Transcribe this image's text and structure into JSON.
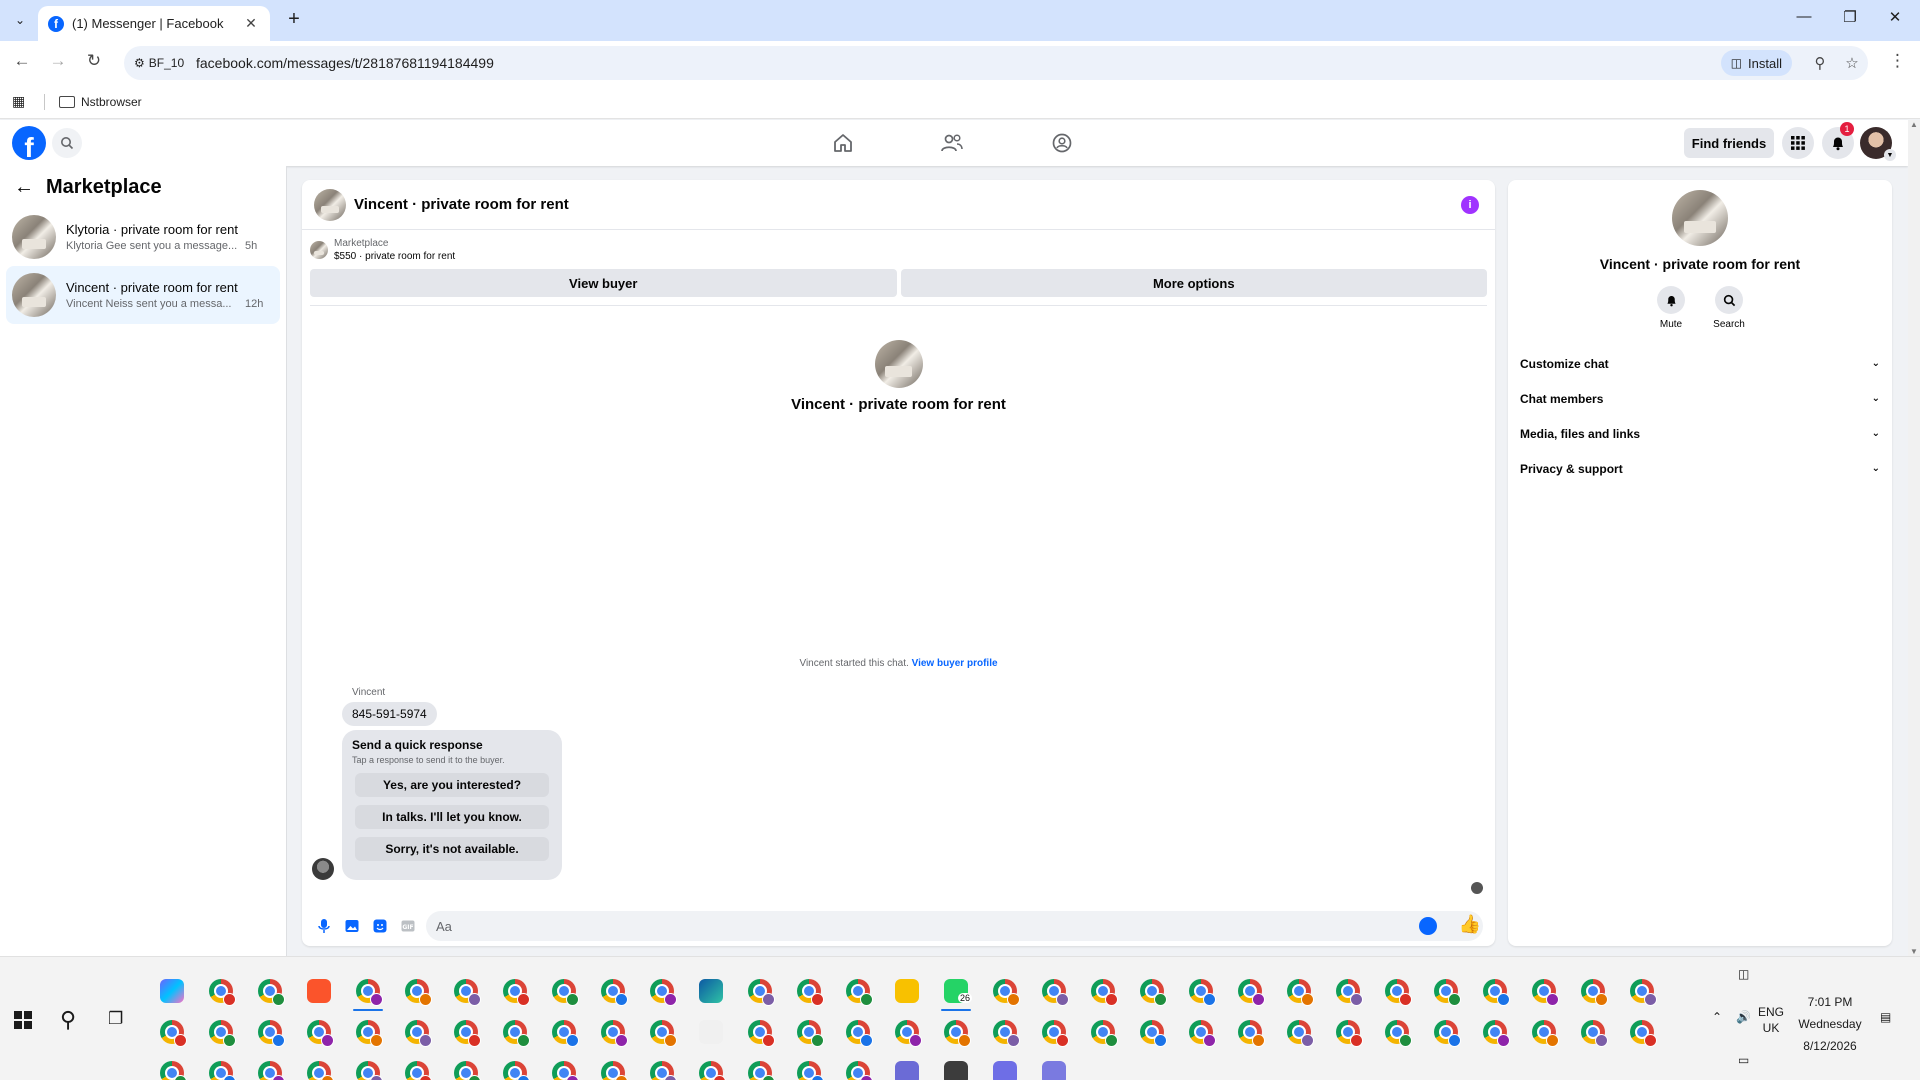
{
  "browser": {
    "tab_title": "(1) Messenger | Facebook",
    "profile_label": "BF_10",
    "url": "facebook.com/messages/t/28187681194184499",
    "install_label": "Install",
    "bookmark_folder": "Nstbrowser"
  },
  "fb_header": {
    "find_friends_label": "Find friends",
    "notification_count": "1"
  },
  "chat_list": {
    "title": "Marketplace",
    "items": [
      {
        "name": "Klytoria · private room for rent",
        "snippet": "Klytoria Gee sent you a message...",
        "time": "5h",
        "active": false
      },
      {
        "name": "Vincent · private room for rent",
        "snippet": "Vincent Neiss sent you a messa...",
        "time": "12h",
        "active": true
      }
    ]
  },
  "conversation": {
    "title": "Vincent · private room for rent",
    "listing_source": "Marketplace",
    "listing_price": "$550 · private room for rent",
    "view_buyer_label": "View buyer",
    "more_options_label": "More options",
    "intro_name": "Vincent · private room for rent",
    "started_text": "Vincent started this chat.",
    "started_link": "View buyer profile",
    "sender_name": "Vincent",
    "message": "845-591-5974",
    "quick_response": {
      "title": "Send a quick response",
      "subtitle": "Tap a response to send it to the buyer.",
      "options": [
        "Yes, are you interested?",
        "In talks. I'll let you know.",
        "Sorry, it's not available."
      ]
    },
    "composer_placeholder": "Aa"
  },
  "info_panel": {
    "name": "Vincent · private room for rent",
    "actions": [
      {
        "label": "Mute",
        "icon": "bell-icon"
      },
      {
        "label": "Search",
        "icon": "search-icon"
      }
    ],
    "sections": [
      "Customize chat",
      "Chat members",
      "Media, files and links",
      "Privacy & support"
    ]
  },
  "taskbar": {
    "whatsapp_badge": "26",
    "language": "ENG",
    "region": "UK",
    "time": "7:01 PM",
    "day": "Wednesday",
    "date": "8/12/2026"
  }
}
